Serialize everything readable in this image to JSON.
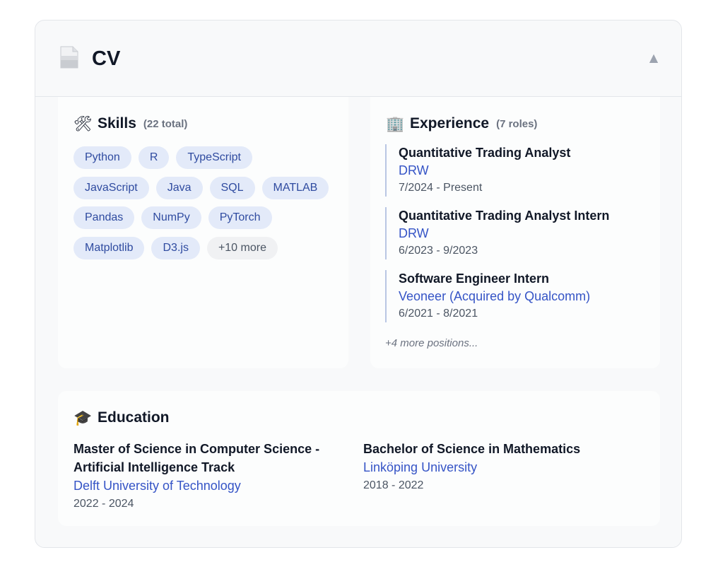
{
  "header": {
    "title": "CV",
    "icon": "document-icon",
    "collapse_glyph": "▲"
  },
  "skills": {
    "emoji": "🛠",
    "title": "Skills",
    "count": "(22 total)",
    "tags": [
      [
        "Python",
        "R",
        "TypeScript"
      ],
      [
        "JavaScript",
        "Java",
        "SQL",
        "MATLAB"
      ],
      [
        "Pandas",
        "NumPy",
        "PyTorch"
      ],
      [
        "Matplotlib",
        "D3.js"
      ]
    ],
    "more_label": "+10 more"
  },
  "experience": {
    "emoji": "🏢",
    "title": "Experience",
    "count": "(7 roles)",
    "items": [
      {
        "role": "Quantitative Trading Analyst",
        "company": "DRW",
        "dates": "7/2024 - Present"
      },
      {
        "role": "Quantitative Trading Analyst Intern",
        "company": "DRW",
        "dates": "6/2023 - 9/2023"
      },
      {
        "role": "Software Engineer Intern",
        "company": "Veoneer (Acquired by Qualcomm)",
        "dates": "6/2021 - 8/2021"
      }
    ],
    "more_label": "+4 more positions..."
  },
  "education": {
    "emoji": "🎓",
    "title": "Education",
    "items": [
      {
        "degree": "Master of Science in Computer Science - Artificial Intelligence Track",
        "school": "Delft University of Technology",
        "dates": "2022 - 2024"
      },
      {
        "degree": "Bachelor of Science in Mathematics",
        "school": "Linköping University",
        "dates": "2018 - 2022"
      }
    ]
  },
  "colors": {
    "link": "#3554c6",
    "tag_bg": "#e3eaf9",
    "tag_text": "#2f4ba0"
  }
}
